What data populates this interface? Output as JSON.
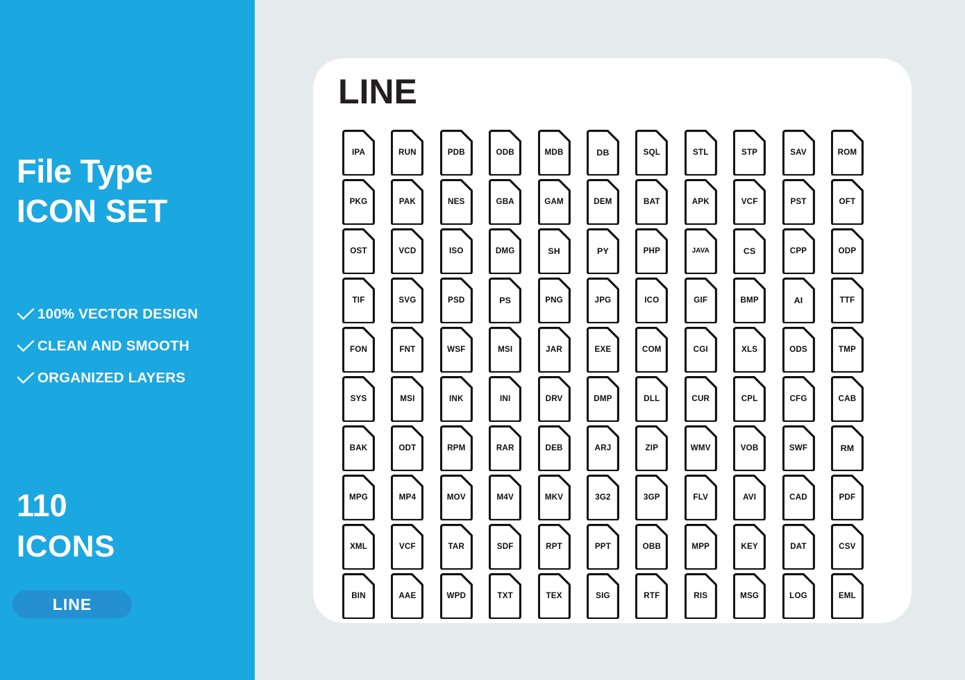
{
  "sidebar": {
    "title_line1": "File Type",
    "title_line2": "ICON SET",
    "features": [
      {
        "icon": "check-icon",
        "label": "100% VECTOR DESIGN"
      },
      {
        "icon": "check-icon",
        "label": "CLEAN AND SMOOTH"
      },
      {
        "icon": "check-icon",
        "label": "ORGANIZED LAYERS"
      }
    ],
    "count_number": "110",
    "count_word": "ICONS",
    "style_badge": "LINE",
    "background_color": "#1ba7e0",
    "badge_color": "#2390cf",
    "text_color": "#ffffff"
  },
  "canvas": {
    "background_color": "#e5eaec",
    "panel_color": "#ffffff"
  },
  "panel": {
    "title": "LINE",
    "title_color": "#231f20",
    "icon_stroke_color": "#111111",
    "columns": 11,
    "rows": 10,
    "total_icons": 110,
    "icon_labels": [
      [
        "IPA",
        "RUN",
        "PDB",
        "ODB",
        "MDB",
        "DB",
        "SQL",
        "STL",
        "STP",
        "SAV",
        "ROM"
      ],
      [
        "PKG",
        "PAK",
        "NES",
        "GBA",
        "GAM",
        "DEM",
        "BAT",
        "APK",
        "VCF",
        "PST",
        "OFT"
      ],
      [
        "OST",
        "VCD",
        "ISO",
        "DMG",
        "SH",
        "PY",
        "PHP",
        "JAVA",
        "CS",
        "CPP",
        "ODP"
      ],
      [
        "TIF",
        "SVG",
        "PSD",
        "PS",
        "PNG",
        "JPG",
        "ICO",
        "GIF",
        "BMP",
        "AI",
        "TTF"
      ],
      [
        "FON",
        "FNT",
        "WSF",
        "MSI",
        "JAR",
        "EXE",
        "COM",
        "CGI",
        "XLS",
        "ODS",
        "TMP"
      ],
      [
        "SYS",
        "MSI",
        "INK",
        "INI",
        "DRV",
        "DMP",
        "DLL",
        "CUR",
        "CPL",
        "CFG",
        "CAB"
      ],
      [
        "BAK",
        "ODT",
        "RPM",
        "RAR",
        "DEB",
        "ARJ",
        "ZIP",
        "WMV",
        "VOB",
        "SWF",
        "RM"
      ],
      [
        "MPG",
        "MP4",
        "MOV",
        "M4V",
        "MKV",
        "3G2",
        "3GP",
        "FLV",
        "AVI",
        "CAD",
        "PDF"
      ],
      [
        "XML",
        "VCF",
        "TAR",
        "SDF",
        "RPT",
        "PPT",
        "OBB",
        "MPP",
        "KEY",
        "DAT",
        "CSV"
      ],
      [
        "BIN",
        "AAE",
        "WPD",
        "TXT",
        "TEX",
        "SIG",
        "RTF",
        "RIS",
        "MSG",
        "LOG",
        "EML"
      ]
    ]
  }
}
